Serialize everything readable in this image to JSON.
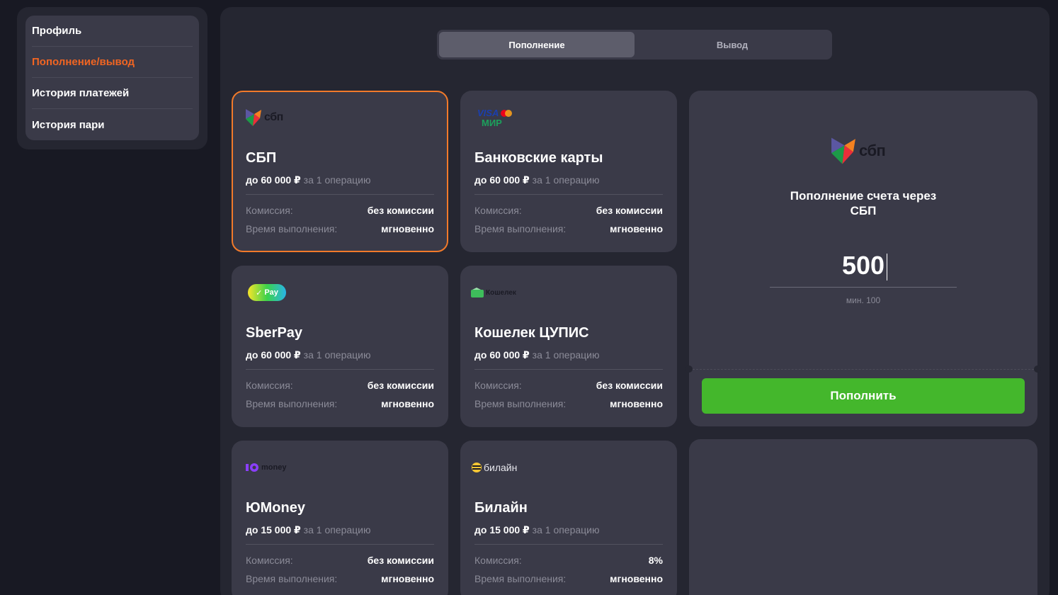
{
  "sidebar": {
    "items": [
      {
        "label": "Профиль",
        "active": false
      },
      {
        "label": "Пополнение/вывод",
        "active": true
      },
      {
        "label": "История платежей",
        "active": false
      },
      {
        "label": "История пари",
        "active": false
      }
    ]
  },
  "tabs": {
    "deposit": "Пополнение",
    "withdraw": "Вывод",
    "active": "deposit"
  },
  "labels": {
    "commission": "Комиссия:",
    "time": "Время выполнения:",
    "per_op": "за 1 операцию"
  },
  "methods": [
    {
      "name": "СБП",
      "limit": "до 60 000 ₽",
      "commission": "без комиссии",
      "time": "мгновенно",
      "icon": "sbp-logo",
      "logo_text": "сбп",
      "selected": true
    },
    {
      "name": "Банковские карты",
      "limit": "до 60 000 ₽",
      "commission": "без комиссии",
      "time": "мгновенно",
      "icon": "visa-mir-logo",
      "logo_text_1": "VISA",
      "logo_text_2": "МИР"
    },
    {
      "name": "SberPay",
      "limit": "до 60 000 ₽",
      "commission": "без комиссии",
      "time": "мгновенно",
      "icon": "sberpay-logo",
      "logo_text": "Pay"
    },
    {
      "name": "Кошелек ЦУПИС",
      "limit": "до 60 000 ₽",
      "commission": "без комиссии",
      "time": "мгновенно",
      "icon": "wallet-logo",
      "logo_text": "Кошелек"
    },
    {
      "name": "ЮMoney",
      "limit": "до 15 000 ₽",
      "commission": "без комиссии",
      "time": "мгновенно",
      "icon": "yoomoney-logo",
      "logo_text": "money"
    },
    {
      "name": "Билайн",
      "limit": "до 15 000 ₽",
      "commission": "8%",
      "time": "мгновенно",
      "icon": "beeline-logo",
      "logo_text": "билайн"
    }
  ],
  "form": {
    "title": "Пополнение счета через СБП",
    "amount": "500",
    "min_note": "мин. 100",
    "submit_label": "Пополнить",
    "logo_text": "сбп"
  },
  "colors": {
    "accent": "#f16522",
    "selected_border": "#f27a2a",
    "submit": "#44b72c",
    "card_bg": "#3a3a48",
    "panel_bg": "#252631"
  }
}
